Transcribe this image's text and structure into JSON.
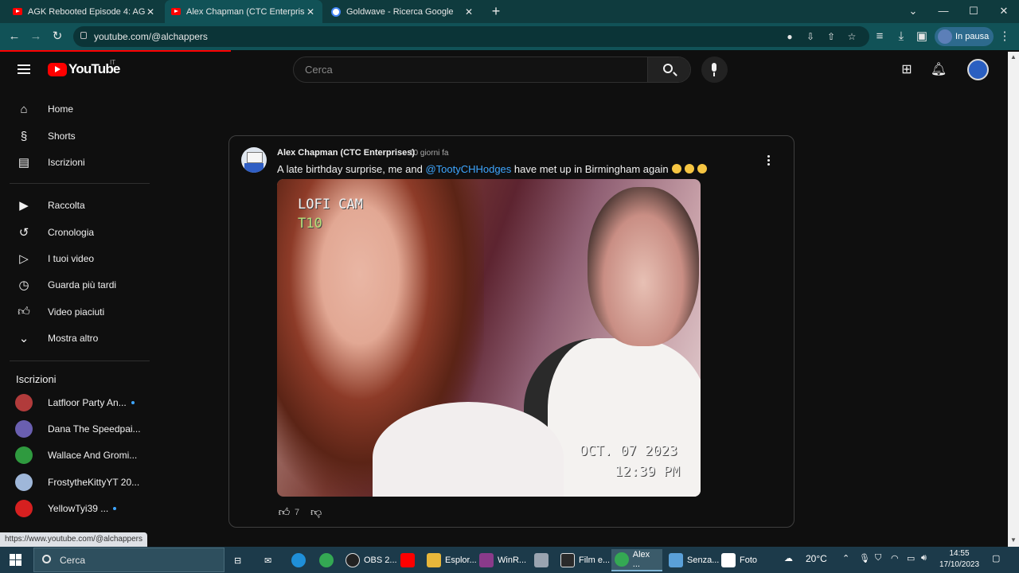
{
  "browser": {
    "tabs": [
      {
        "title": "AGK Rebooted Episode 4: AGK D",
        "icon": "youtube-favicon",
        "active": false
      },
      {
        "title": "Alex Chapman (CTC Enterprises)",
        "icon": "youtube-favicon",
        "active": true
      },
      {
        "title": "Goldwave - Ricerca Google",
        "icon": "google-favicon",
        "active": false
      }
    ],
    "url": "youtube.com/@alchappers",
    "profile_status": "In pausa",
    "status_url": "https://www.youtube.com/@alchappers"
  },
  "youtube": {
    "logo_text": "YouTube",
    "country_code": "IT",
    "search_placeholder": "Cerca"
  },
  "sidebar": {
    "primary": [
      {
        "label": "Home",
        "icon": "home-icon"
      },
      {
        "label": "Shorts",
        "icon": "shorts-icon"
      },
      {
        "label": "Iscrizioni",
        "icon": "subscriptions-icon"
      }
    ],
    "secondary": [
      {
        "label": "Raccolta",
        "icon": "library-icon"
      },
      {
        "label": "Cronologia",
        "icon": "history-icon"
      },
      {
        "label": "I tuoi video",
        "icon": "your-videos-icon"
      },
      {
        "label": "Guarda più tardi",
        "icon": "watch-later-icon"
      },
      {
        "label": "Video piaciuti",
        "icon": "liked-icon"
      },
      {
        "label": "Mostra altro",
        "icon": "chevron-down-icon"
      }
    ],
    "subscriptions_heading": "Iscrizioni",
    "subscriptions": [
      {
        "label": "Latfloor Party An...",
        "color": "#b13b3b",
        "new": true
      },
      {
        "label": "Dana The Speedpai...",
        "color": "#6a5fb0",
        "new": false
      },
      {
        "label": "Wallace And Gromi...",
        "color": "#2f9a3f",
        "new": false
      },
      {
        "label": "FrostytheKittyYT 20...",
        "color": "#9fb7d9",
        "new": false
      },
      {
        "label": "YellowTyi39 ...",
        "color": "#d62020",
        "new": true
      }
    ]
  },
  "post": {
    "author": "Alex Chapman (CTC Enterprises)",
    "time_ago": "10 giorni fa",
    "text_before": "A late birthday surprise, me and ",
    "mention": "@TootyCHHodges",
    "text_after": " have met up in Birmingham again",
    "photo_overlay": {
      "cam": "LOFI CAM",
      "mode": "T10",
      "date": "OCT. 07 2023",
      "time": "12:39 PM"
    },
    "likes": "7"
  },
  "taskbar": {
    "search_placeholder": "Cerca",
    "apps": [
      {
        "label": "OBS 2...",
        "color": "#222222"
      },
      {
        "label": "Esplor...",
        "color": "#e8b73a"
      },
      {
        "label": "WinR...",
        "color": "#8a3a8a"
      },
      {
        "label": "Film e...",
        "color": "#2a2a2a"
      },
      {
        "label": "Alex ...",
        "color": "#34a853"
      },
      {
        "label": "Senza...",
        "color": "#5aa0d8"
      },
      {
        "label": "Foto",
        "color": "#ffffff"
      }
    ],
    "weather": "20°C",
    "time": "14:55",
    "date": "17/10/2023"
  }
}
